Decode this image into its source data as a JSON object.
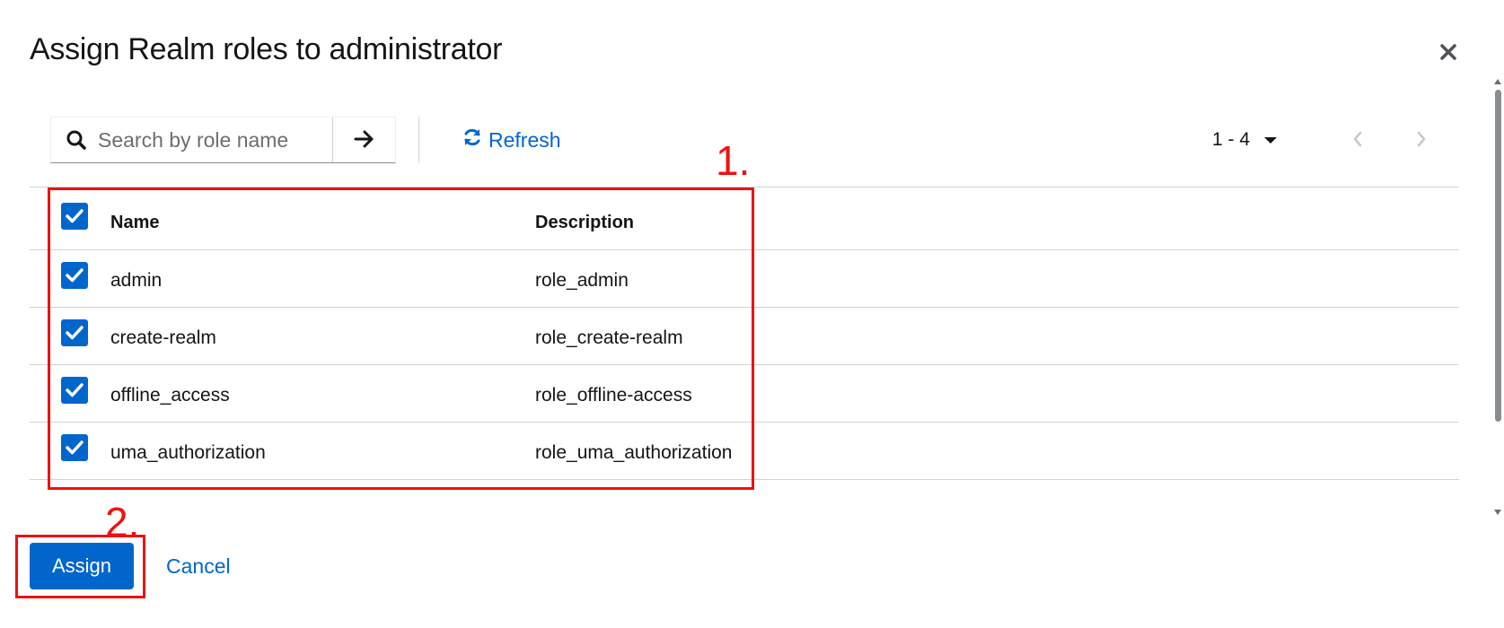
{
  "modal": {
    "title": "Assign Realm roles to administrator",
    "close_icon": "close-icon"
  },
  "toolbar": {
    "search_placeholder": "Search by role name",
    "search_value": "",
    "search_icon": "search-icon",
    "submit_icon": "arrow-right-icon",
    "refresh_label": "Refresh",
    "refresh_icon": "sync-icon",
    "pagination_label": "1 - 4",
    "prev_icon": "chevron-left-icon",
    "next_icon": "chevron-right-icon"
  },
  "table": {
    "columns": [
      "Name",
      "Description"
    ],
    "select_all_checked": true,
    "rows": [
      {
        "name": "admin",
        "description": "role_admin",
        "checked": true
      },
      {
        "name": "create-realm",
        "description": "role_create-realm",
        "checked": true
      },
      {
        "name": "offline_access",
        "description": "role_offline-access",
        "checked": true
      },
      {
        "name": "uma_authorization",
        "description": "role_uma_authorization",
        "checked": true
      }
    ]
  },
  "footer": {
    "assign_label": "Assign",
    "cancel_label": "Cancel"
  },
  "annotations": {
    "step1": "1.",
    "step2": "2."
  },
  "colors": {
    "primary": "#0066cc",
    "annotation": "#ee1111",
    "border": "#d2d2d2"
  }
}
